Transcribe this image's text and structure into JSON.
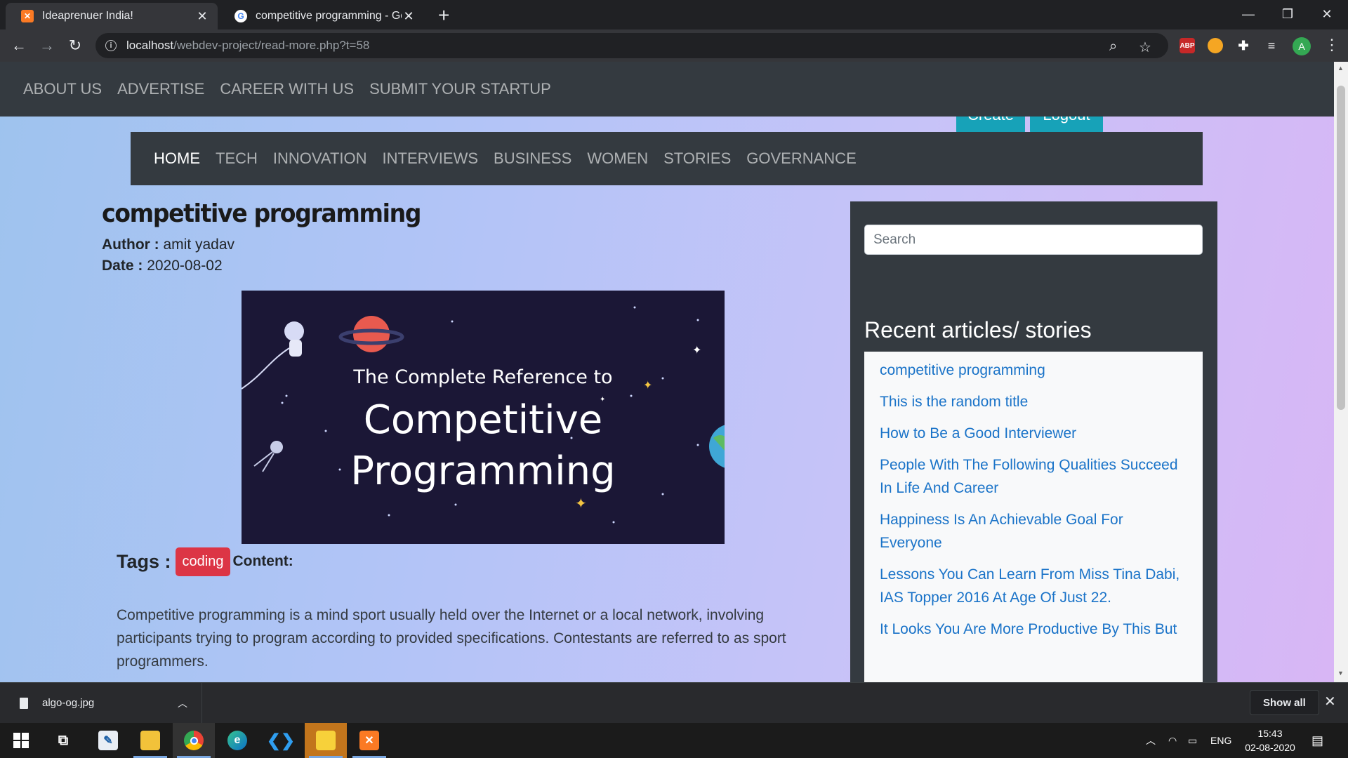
{
  "browser": {
    "tabs": [
      {
        "title": "Ideaprenuer India!",
        "favicon": "xampp-icon",
        "active": true
      },
      {
        "title": "competitive programming - Goo",
        "favicon": "google-icon",
        "active": false
      }
    ],
    "url_host": "localhost",
    "url_path": "/webdev-project/read-more.php?t=58"
  },
  "site": {
    "top_nav": [
      "ABOUT US",
      "ADVERTISE",
      "CAREER WITH US",
      "SUBMIT YOUR STARTUP"
    ],
    "peek_buttons": [
      "Create",
      "Logout"
    ],
    "category_nav": [
      "HOME",
      "TECH",
      "INNOVATION",
      "INTERVIEWS",
      "BUSINESS",
      "WOMEN",
      "STORIES",
      "GOVERNANCE"
    ],
    "category_active": "HOME"
  },
  "article": {
    "title": "competitive programming",
    "author_label": "Author :",
    "author": "amit yadav",
    "date_label": "Date :",
    "date": "2020-08-02",
    "image": {
      "line1": "The Complete Reference to",
      "line2": "Competitive",
      "line3": "Programming"
    },
    "tags_label": "Tags :",
    "tags": [
      "coding"
    ],
    "content_label": "Content:",
    "content": "Competitive programming is a mind sport usually held over the Internet or a local network, involving participants trying to program according to provided specifications. Contestants are referred to as sport programmers."
  },
  "sidebar": {
    "search_placeholder": "Search",
    "heading": "Recent articles/ stories",
    "recent": [
      "competitive programming",
      "This is the random title",
      "How to Be a Good Interviewer",
      "People With The Following Qualities Succeed In Life And Career",
      "Happiness Is An Achievable Goal For Everyone",
      "Lessons You Can Learn From Miss Tina Dabi, IAS Topper 2016 At Age Of Just 22.",
      "It Looks You Are More Productive By This But"
    ]
  },
  "downloads": {
    "file": "algo-og.jpg",
    "show_all": "Show all"
  },
  "taskbar": {
    "lang": "ENG",
    "time": "15:43",
    "date": "02-08-2020"
  },
  "colors": {
    "navbar": "#343a40",
    "link": "#1a73c8",
    "tag_badge": "#dc3545",
    "peek_button": "#17a2b8"
  }
}
